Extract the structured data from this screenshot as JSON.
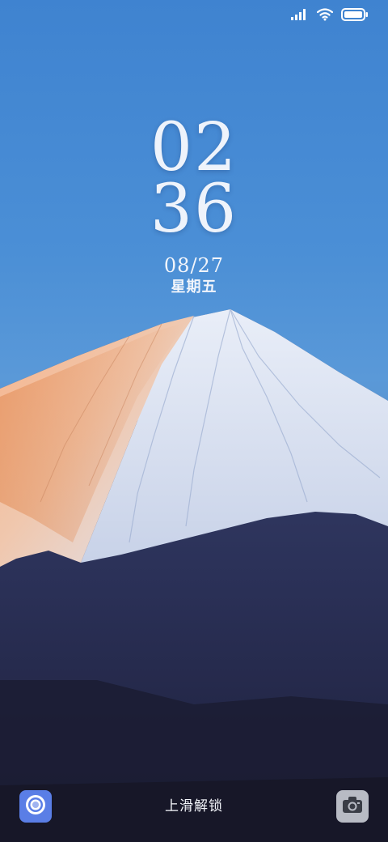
{
  "status_bar": {
    "icons": [
      "signal-icon",
      "wifi-icon",
      "battery-icon"
    ]
  },
  "clock": {
    "hours": "02",
    "minutes": "36"
  },
  "date": {
    "date": "08/27",
    "weekday": "星期五"
  },
  "bottom": {
    "unlock_hint": "上滑解锁",
    "left_button_icon": "assistant-icon",
    "right_button_icon": "camera-icon"
  },
  "colors": {
    "sky_top": "#3f83d0",
    "clock_text": "#eef3fb",
    "assistant_button": "#5a7ee6",
    "camera_button": "#b8bbc4"
  }
}
